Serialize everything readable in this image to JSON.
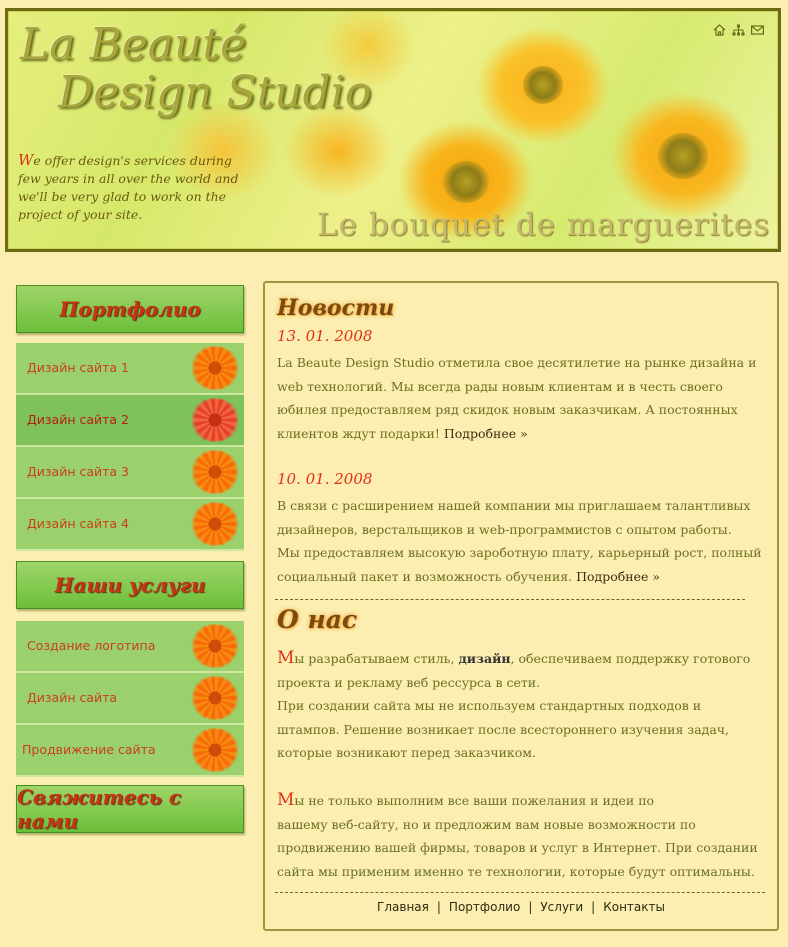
{
  "header": {
    "logo_line1": "La Beauté",
    "logo_line2": "Design Studio",
    "slogan_first": "W",
    "slogan_rest": "e offer design's services during few years in all over the world and we'll be very glad to work on the project of your site.",
    "tagline": "Le bouquet de marguerites",
    "icons": [
      "home-icon",
      "sitemap-icon",
      "mail-icon"
    ]
  },
  "sidebar": {
    "portfolio_title": "Портфолио",
    "portfolio_items": [
      {
        "label": "Дизайн сайта 1",
        "active": false
      },
      {
        "label": "Дизайн сайта 2",
        "active": true
      },
      {
        "label": "Дизайн сайта 3",
        "active": false
      },
      {
        "label": "Дизайн сайта 4",
        "active": false
      }
    ],
    "services_title": "Наши услуги",
    "services_items": [
      {
        "label": "Создание логотипа"
      },
      {
        "label": "Дизайн сайта"
      },
      {
        "label": "Продвижение сайта"
      }
    ],
    "contact_title": "Свяжитесь с нами"
  },
  "news": {
    "title": "Новости",
    "items": [
      {
        "date": "13. 01. 2008",
        "text": "La Beaute Design Studio отметила свое десятилетие на рынке дизайна и web технологий. Мы всегда рады новым клиентам и в честь своего юбилея предоставляем ряд скидок новым заказчикам. А постоянных клиентов ждут подарки!",
        "more": "Подробнее »"
      },
      {
        "date": "10. 01. 2008",
        "text1": "В связи с расширением нашей компании мы приглашаем талантливых дизайнеров, верстальщиков и web-программистов с опытом работы.",
        "text2": "Мы предоставляем высокую зароботную плату, карьерный рост, полный социальный пакет и возможность обучения.",
        "more": "Подробнее »"
      }
    ]
  },
  "about": {
    "title": "О нас",
    "p1_cap": "М",
    "p1_a": "ы разрабатываем стиль, ",
    "p1_bold": "дизайн",
    "p1_b": ", обеспечиваем поддержку готового проекта и рекламу веб рессурса в сети.",
    "p1_c": "При создании сайта мы не используем стандартных подходов и штампов. Решение возникает после всестороннего изучения задач, которые возникают перед заказчиком.",
    "p2_cap": "М",
    "p2_a": "ы не только выполним все ваши пожелания и идеи по",
    "p2_b": "вашему веб-сайту, но и предложим вам новые возможности по продвижению вашей фирмы, товаров и услуг в Интернет. При создании сайта мы применим именно те технологии, которые будут оптимальны."
  },
  "footer": {
    "links": [
      "Главная",
      "Портфолио",
      "Услуги",
      "Контакты"
    ],
    "separator": "|"
  },
  "colors": {
    "page_bg": "#fbeeb0",
    "menu_green": "#9bd16c",
    "accent_red": "#e23018",
    "text_olive": "#6b7022"
  }
}
